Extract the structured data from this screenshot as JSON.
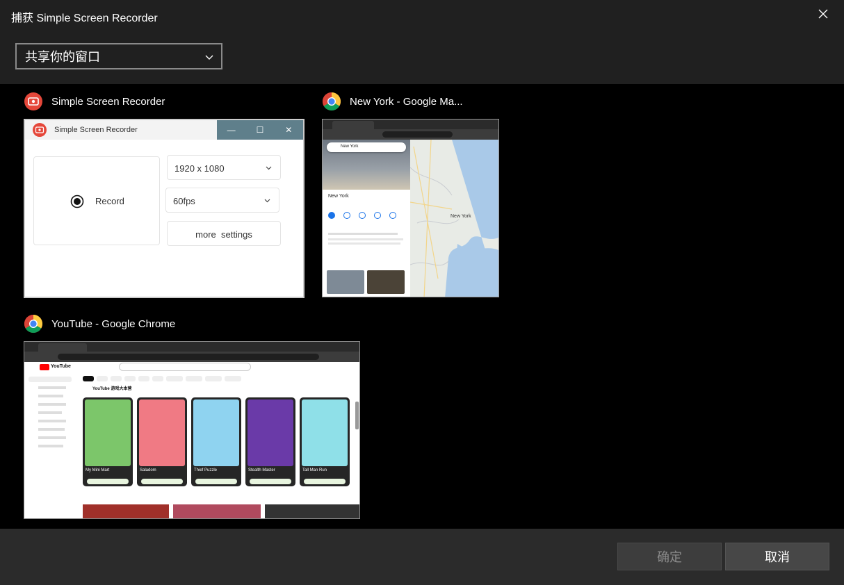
{
  "dialog": {
    "title": "捕获 Simple Screen Recorder",
    "close_icon": "close-icon"
  },
  "source_select": {
    "value": "共享你的窗口",
    "icon": "chevron-down-icon"
  },
  "windows": [
    {
      "label": "Simple Screen Recorder",
      "icon": "ssr-app-icon",
      "preview": {
        "app_title": "Simple Screen Recorder",
        "record_label": "Record",
        "resolution": "1920 x 1080",
        "fps": "60fps",
        "settings_label": "more  settings",
        "window_controls": [
          "—",
          "☐",
          "✕"
        ]
      }
    },
    {
      "label": "New York - Google Ma...",
      "icon": "chrome-icon",
      "preview": {
        "search_text": "New York",
        "place_title": "New York",
        "city_label": "New York"
      }
    },
    {
      "label": "YouTube - Google Chrome",
      "icon": "chrome-icon",
      "preview": {
        "logo": "YouTube",
        "section_title": "YouTube 游戏大本营",
        "games": [
          "My Mini Mart",
          "Saladom",
          "Thief Puzzle",
          "Stealth Master",
          "Tall Man Run"
        ]
      }
    }
  ],
  "footer": {
    "ok_label": "确定",
    "cancel_label": "取消"
  },
  "colors": {
    "dialog_bg": "#202020",
    "content_bg": "#000000",
    "footer_bg": "#2b2b2b",
    "ssr_accent": "#e5473a",
    "ssr_titlebar_controls": "#5f7f8b"
  }
}
